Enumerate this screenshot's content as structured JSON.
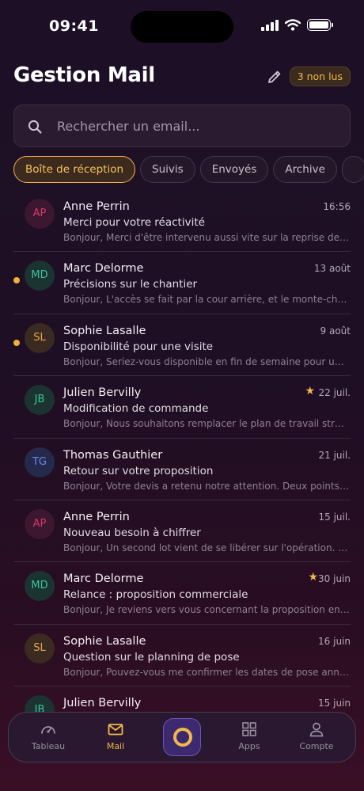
{
  "status_bar": {
    "time": "09:41"
  },
  "header": {
    "title": "Gestion Mail",
    "unread_badge": "3 non lus"
  },
  "search": {
    "placeholder": "Rechercher un email..."
  },
  "tabs": [
    {
      "label": "Boîte de réception",
      "active": true
    },
    {
      "label": "Suivis",
      "active": false
    },
    {
      "label": "Envoyés",
      "active": false
    },
    {
      "label": "Archive",
      "active": false
    },
    {
      "label": "",
      "active": false
    }
  ],
  "mails": [
    {
      "initials": "AP",
      "sender": "Anne Perrin",
      "date": "16:56",
      "subject": "Merci pour votre réactivité",
      "preview": "Bonjour, Merci d'être intervenu aussi vite sur la reprise des c...",
      "unread": false,
      "starred": false,
      "avatar_color": "#d13a6a",
      "avatar_bg": "#3b1830"
    },
    {
      "initials": "MD",
      "sender": "Marc Delorme",
      "date": "13 août",
      "subject": "Précisions sur le chantier",
      "preview": "Bonjour, L'accès se fait par la cour arrière, et le monte-char...",
      "unread": true,
      "starred": false,
      "avatar_color": "#3cc29a",
      "avatar_bg": "#1b3431"
    },
    {
      "initials": "SL",
      "sender": "Sophie Lasalle",
      "date": "9 août",
      "subject": "Disponibilité pour une visite",
      "preview": "Bonjour, Seriez-vous disponible en fin de semaine pour une...",
      "unread": true,
      "starred": false,
      "avatar_color": "#e3a94a",
      "avatar_bg": "#3a2a22"
    },
    {
      "initials": "JB",
      "sender": "Julien Bervilly",
      "date": "22 juil.",
      "subject": "Modification de commande",
      "preview": "Bonjour, Nous souhaitons remplacer le plan de travail strati...",
      "unread": false,
      "starred": true,
      "avatar_color": "#3cc29a",
      "avatar_bg": "#1b3431"
    },
    {
      "initials": "TG",
      "sender": "Thomas Gauthier",
      "date": "21 juil.",
      "subject": "Retour sur votre proposition",
      "preview": "Bonjour, Votre devis a retenu notre attention. Deux points re...",
      "unread": false,
      "starred": false,
      "avatar_color": "#6b86f0",
      "avatar_bg": "#252a4c"
    },
    {
      "initials": "AP",
      "sender": "Anne Perrin",
      "date": "15 juil.",
      "subject": "Nouveau besoin à chiffrer",
      "preview": "Bonjour, Un second lot vient de se libérer sur l'opération. Po...",
      "unread": false,
      "starred": false,
      "avatar_color": "#d13a6a",
      "avatar_bg": "#3b1830"
    },
    {
      "initials": "MD",
      "sender": "Marc Delorme",
      "date": "30 juin",
      "subject": "Relance : proposition commerciale",
      "preview": "Bonjour, Je reviens vers vous concernant la proposition env...",
      "unread": false,
      "starred": true,
      "avatar_color": "#3cc29a",
      "avatar_bg": "#1b3431"
    },
    {
      "initials": "SL",
      "sender": "Sophie Lasalle",
      "date": "16 juin",
      "subject": "Question sur le planning de pose",
      "preview": "Bonjour, Pouvez-vous me confirmer les dates de pose anno...",
      "unread": false,
      "starred": false,
      "avatar_color": "#e3a94a",
      "avatar_bg": "#3a2a22"
    },
    {
      "initials": "JB",
      "sender": "Julien Bervilly",
      "date": "15 juin",
      "subject": "",
      "preview": "",
      "unread": false,
      "starred": false,
      "avatar_color": "#3cc29a",
      "avatar_bg": "#1b3431"
    }
  ],
  "bottom_nav": [
    {
      "label": "Tableau",
      "icon": "gauge-icon",
      "active": false
    },
    {
      "label": "Mail",
      "icon": "mail-icon",
      "active": true
    },
    {
      "label": "",
      "icon": "logo-ring-icon",
      "active": false
    },
    {
      "label": "Apps",
      "icon": "grid-icon",
      "active": false
    },
    {
      "label": "Compte",
      "icon": "user-icon",
      "active": false
    }
  ],
  "colors": {
    "accent": "#f2b84b",
    "unread_dot": "#f0b23e",
    "center_button": "#3d2970"
  }
}
